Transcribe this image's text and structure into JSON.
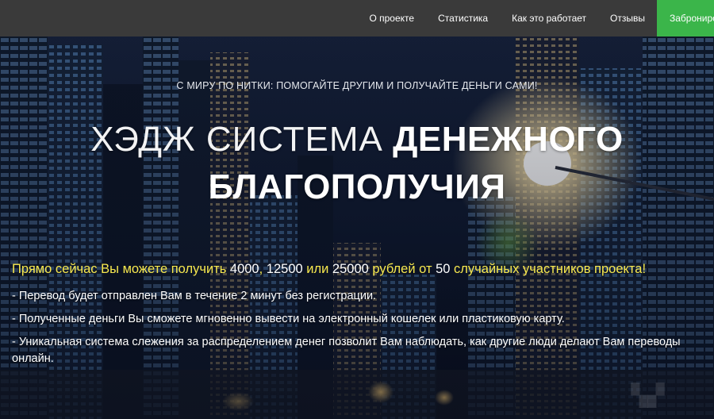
{
  "nav": {
    "items": [
      {
        "label": "О проекте"
      },
      {
        "label": "Статистика"
      },
      {
        "label": "Как это работает"
      },
      {
        "label": "Отзывы"
      }
    ],
    "cta_label": "Забронировать"
  },
  "hero": {
    "tagline": "С МИРУ ПО НИТКИ: ПОМОГАЙТЕ ДРУГИМ И ПОЛУЧАЙТЕ ДЕНЬГИ САМИ!",
    "headline_light": "ХЭДЖ СИСТЕМА",
    "headline_bold": "ДЕНЕЖНОГО БЛАГОПОЛУЧИЯ"
  },
  "offer": {
    "lead_part1": "Прямо сейчас Вы можете получить ",
    "amount1": "4000",
    "sep1": ", ",
    "amount2": "12500",
    "sep2": " или ",
    "amount3": "25000",
    "lead_part2": " рублей от ",
    "amount4": "50",
    "lead_part3": " случайных участников проекта!",
    "bullets": [
      "- Перевод будет отправлен Вам в течение 2 минут без регистрации.",
      "- Полученные деньги Вы сможете мгновенно вывести на электронный кошелек или пластиковую карту.",
      "- Уникальная система слежения за распределением денег позволит Вам наблюдать, как другие люди делают Вам переводы онлайн."
    ]
  },
  "colors": {
    "nav_bg": "#3a3a3a",
    "cta_bg": "#3bb54a",
    "lead_text": "#f7e84e"
  }
}
